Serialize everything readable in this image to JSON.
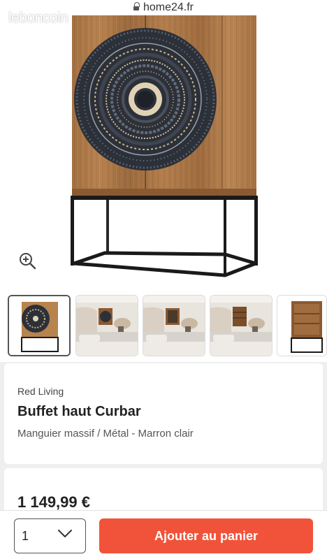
{
  "browser": {
    "url": "home24.fr"
  },
  "watermark": "leboncoin",
  "icons": {
    "zoom": "zoom-in-icon",
    "lock": "lock-icon",
    "dropdown": "chevron-down-icon"
  },
  "product": {
    "brand": "Red Living",
    "name": "Buffet haut Curbar",
    "material": "Manguier massif / Métal - Marron clair",
    "price": "1 149,99 €"
  },
  "cart": {
    "quantity": "1",
    "add_label": "Ajouter au panier"
  },
  "colors": {
    "accent": "#f1533a",
    "wood": "#b7834f",
    "metal": "#1a1a1a"
  }
}
